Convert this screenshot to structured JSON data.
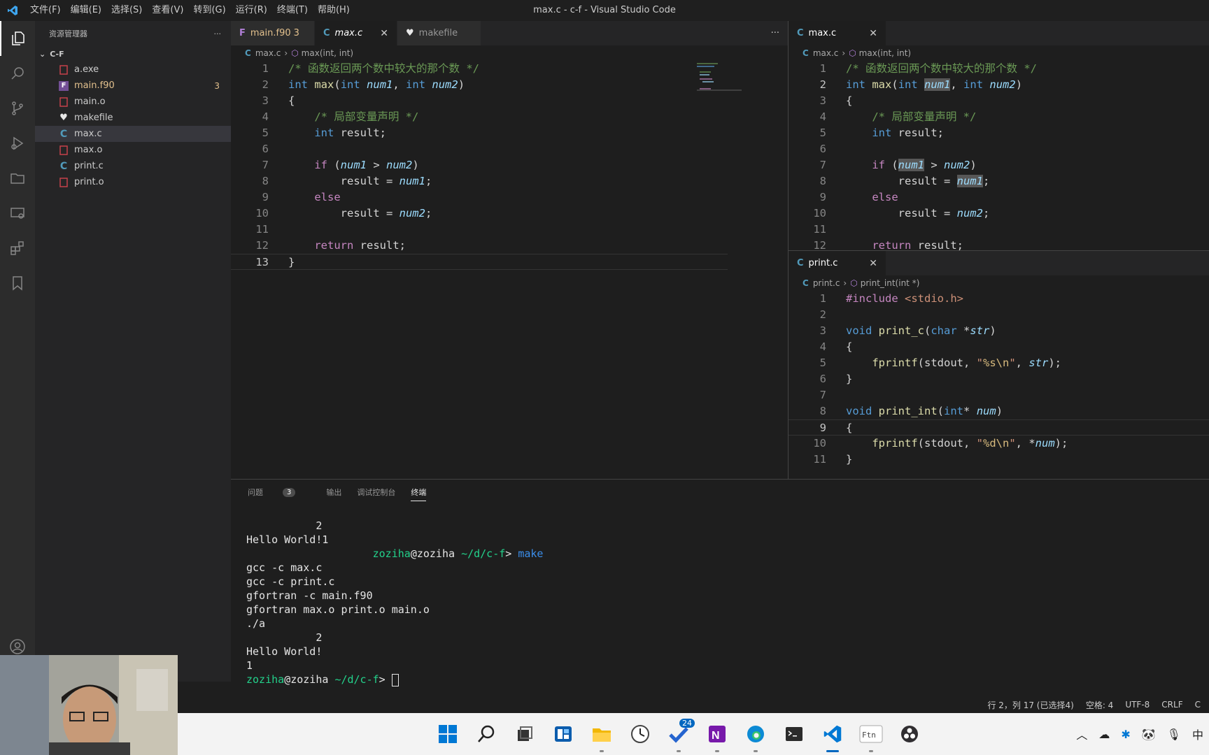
{
  "window": {
    "title": "max.c - c-f - Visual Studio Code"
  },
  "menu": [
    "文件(F)",
    "编辑(E)",
    "选择(S)",
    "查看(V)",
    "转到(G)",
    "运行(R)",
    "终端(T)",
    "帮助(H)"
  ],
  "sidebar": {
    "title": "资源管理器",
    "more": "···",
    "folder": "C-F",
    "files": [
      {
        "name": "a.exe",
        "icon": "binary-file-icon",
        "color": "#c5c5c5"
      },
      {
        "name": "main.f90",
        "icon": "fortran-file-icon",
        "color": "#e2c08d",
        "badge": "3"
      },
      {
        "name": "main.o",
        "icon": "binary-file-icon",
        "color": "#c5c5c5"
      },
      {
        "name": "makefile",
        "icon": "makefile-icon",
        "color": "#c5c5c5"
      },
      {
        "name": "max.c",
        "icon": "c-file-icon",
        "color": "#c5c5c5",
        "selected": true
      },
      {
        "name": "max.o",
        "icon": "binary-file-icon",
        "color": "#c5c5c5"
      },
      {
        "name": "print.c",
        "icon": "c-file-icon",
        "color": "#c5c5c5"
      },
      {
        "name": "print.o",
        "icon": "binary-file-icon",
        "color": "#c5c5c5"
      }
    ]
  },
  "editor1": {
    "tabs": [
      {
        "label": "main.f90",
        "icon": "F",
        "badge": "3"
      },
      {
        "label": "max.c",
        "icon": "C",
        "close": "✕",
        "active": true
      },
      {
        "label": "makefile",
        "icon": "♥"
      }
    ],
    "more": "···",
    "crumbs": {
      "file": "max.c",
      "symbol": "max(int, int)"
    }
  },
  "editor2": {
    "tab": {
      "label": "max.c",
      "close": "✕"
    },
    "crumbs": {
      "file": "max.c",
      "symbol": "max(int, int)"
    }
  },
  "editor3": {
    "tab": {
      "label": "print.c",
      "close": "✕"
    },
    "crumbs": {
      "file": "print.c",
      "symbol": "print_int(int *)"
    }
  },
  "panel": {
    "tabs": [
      {
        "label": "问题",
        "badge": "3"
      },
      {
        "label": "输出"
      },
      {
        "label": "调试控制台"
      },
      {
        "label": "终端",
        "active": true
      }
    ],
    "terminal": [
      "           2",
      "Hello World!1",
      "                    zoziha@zoziha ~/d/c-f> make",
      "gcc -c max.c",
      "gcc -c print.c",
      "gfortran -c main.f90",
      "gfortran max.o print.o main.o",
      "./a",
      "           2",
      "Hello World!",
      "1",
      "zoziha@zoziha ~/d/c-f> "
    ]
  },
  "statusbar": {
    "position": "行 2，列 17 (已选择4)",
    "spaces": "空格: 4",
    "encoding": "UTF-8",
    "eol": "CRLF",
    "language": "C"
  },
  "taskbar": {
    "apps": [
      "windows-start-icon",
      "search-icon",
      "task-view-icon",
      "widgets-icon",
      "file-explorer-icon",
      "clock-app-icon",
      "todo-app-icon",
      "onenote-icon",
      "edge-icon",
      "terminal-icon",
      "vscode-icon",
      "fortran-app-icon",
      "obs-icon"
    ],
    "todo_badge": "24",
    "ime": "中"
  },
  "colors": {
    "accent": "#0078d4",
    "keyword": "#569cd6",
    "function": "#dcdcaa",
    "comment": "#6a9955",
    "param": "#9cdcfe",
    "string": "#ce9178"
  }
}
